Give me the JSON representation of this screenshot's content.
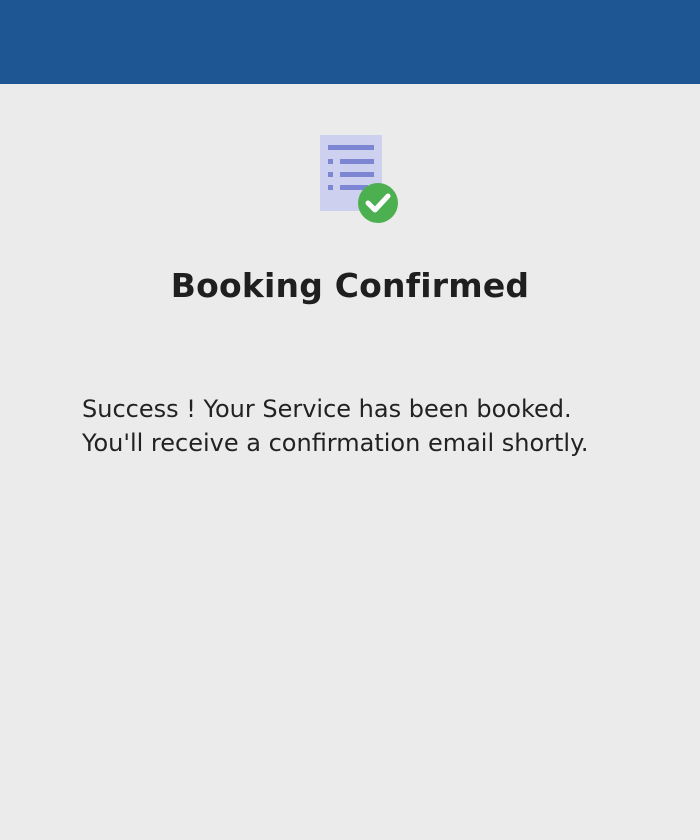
{
  "colors": {
    "header_bar": "#1e5593",
    "background": "#ebebeb",
    "document_fill": "#cdd1ef",
    "document_lines": "#7d86d3",
    "check_circle": "#4caf50",
    "text": "#1f1f1f"
  },
  "icon": {
    "name": "document-checkmark-icon"
  },
  "confirmation": {
    "title": "Booking Confirmed",
    "message_line1": "Success ! Your Service has been booked.",
    "message_line2": "You'll receive a confirmation email shortly."
  }
}
